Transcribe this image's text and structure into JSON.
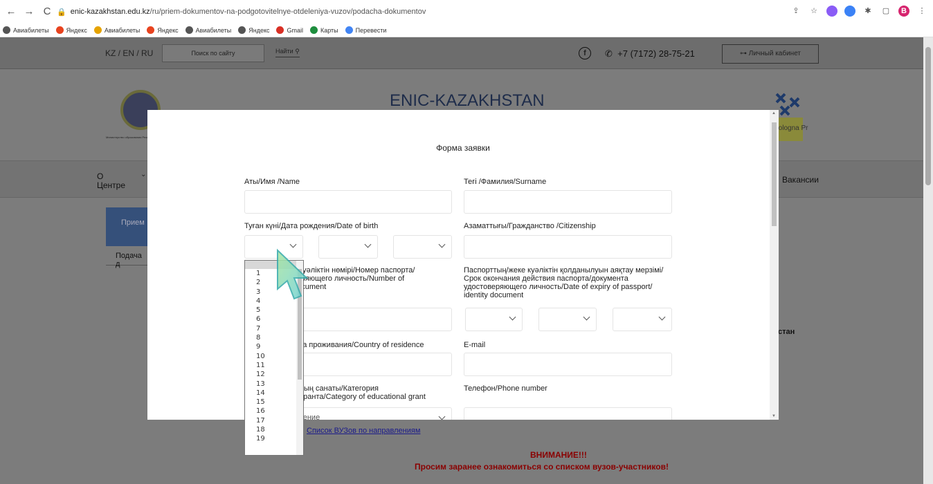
{
  "browser": {
    "url_host": "enic-kazakhstan.edu.kz",
    "url_path": "/ru/priem-dokumentov-na-podgotovitelnye-otdeleniya-vuzov/podacha-dokumentov",
    "avatar_letter": "B"
  },
  "bookmarks": [
    {
      "label": "Авиабилеты",
      "color": "#555"
    },
    {
      "label": "Яндекс",
      "color": "#e8431f"
    },
    {
      "label": "Авиабилеты",
      "color": "#e6a300"
    },
    {
      "label": "Яндекс",
      "color": "#e8431f"
    },
    {
      "label": "Авиабилеты",
      "color": "#555"
    },
    {
      "label": "Яндекс",
      "color": "#555"
    },
    {
      "label": "Gmail",
      "color": "#d93025"
    },
    {
      "label": "Карты",
      "color": "#1e8e3e"
    },
    {
      "label": "Перевести",
      "color": "#4285f4"
    }
  ],
  "header": {
    "lang": "KZ /  EN /  RU",
    "search_placeholder": "Поиск по сайту",
    "search_button": "Найти",
    "phone": "+7 (7172) 28-75-21",
    "cabinet": "Личный кабинет",
    "site_title": "ENIC-KAZAKHSTAN",
    "logo_left_caption": "Министерство образования Республики Казахстан",
    "logo_right_caption": "Bologna Process"
  },
  "menu": {
    "about": "О\nЦентре",
    "vacancies": "Вакансии"
  },
  "sidebar": {
    "active": "Прием",
    "item": "Подача д"
  },
  "background": {
    "kz_text": "стан",
    "vuz_link": "Список ВУЗов по направлениям",
    "warning_1": "ВНИМАНИЕ!!!",
    "warning_2": "Просим заранее ознакомиться со списком вузов-участников!"
  },
  "form": {
    "title": "Форма заявки",
    "name_label": "Аты/Имя /Name",
    "surname_label": "Тегі /Фамилия/Surname",
    "dob_label": "Туған күні/Дата рождения/Date of birth",
    "citizenship_label": "Азаматтығы/Гражданство /Citizenship",
    "passport_label": "е куәліктін нөмірі/Номер паспорта/\nверяющего личность/Number of\ndocument",
    "expiry_label": "Паспорттың/жеке куәліктін қолданылуын аяқтау мерзімі/\nСрок окончания действия паспорта/документа\nудостоверяющего личность/Date of expiry of passport/\nidentity document",
    "residence_label": "ана проживания/Country of residence",
    "email_label": "E-mail",
    "grant_label": "ының санаты/Категория\nо гранта/Category of educational grant",
    "phone_label": "Телефон/Phone number",
    "grant_select_partial": "чение"
  },
  "dropdown": {
    "options": [
      "1",
      "2",
      "3",
      "4",
      "5",
      "6",
      "7",
      "8",
      "9",
      "10",
      "11",
      "12",
      "13",
      "14",
      "15",
      "16",
      "17",
      "18",
      "19"
    ]
  }
}
